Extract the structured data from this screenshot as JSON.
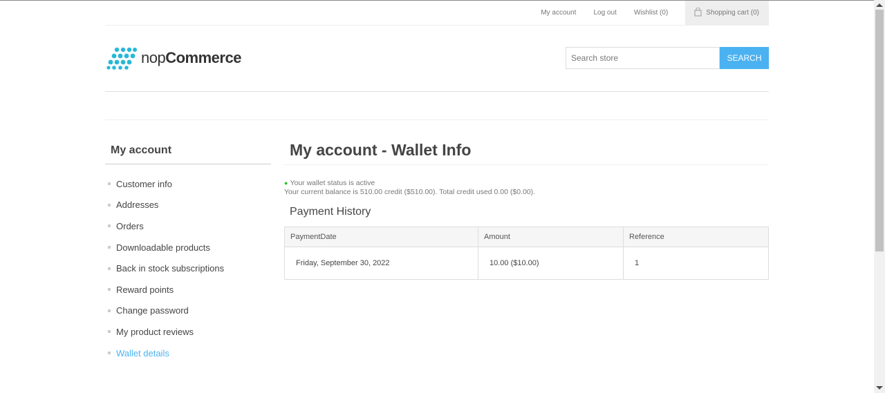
{
  "header": {
    "links": {
      "my_account": "My account",
      "log_out": "Log out",
      "wishlist": "Wishlist (0)",
      "shopping_cart": "Shopping cart (0)"
    },
    "logo": {
      "prefix": "nop",
      "brand": "Commerce"
    },
    "search": {
      "placeholder": "Search store",
      "button_label": "SEARCH"
    }
  },
  "sidebar": {
    "title": "My account",
    "items": [
      {
        "label": "Customer info"
      },
      {
        "label": "Addresses"
      },
      {
        "label": "Orders"
      },
      {
        "label": "Downloadable products"
      },
      {
        "label": "Back in stock subscriptions"
      },
      {
        "label": "Reward points"
      },
      {
        "label": "Change password"
      },
      {
        "label": "My product reviews"
      },
      {
        "label": "Wallet details",
        "active": true
      }
    ]
  },
  "main": {
    "title": "My account - Wallet Info",
    "status_text": "Your wallet status is active",
    "balance_text": "Your current balance is 510.00 credit ($510.00). Total credit used 0.00 ($0.00).",
    "section_title": "Payment History",
    "table": {
      "headers": [
        "PaymentDate",
        "Amount",
        "Reference"
      ],
      "rows": [
        [
          "Friday, September 30, 2022",
          "10.00 ($10.00)",
          "1"
        ]
      ]
    }
  },
  "colors": {
    "accent": "#4ab2f1",
    "status_active": "#25c225",
    "logo_dots": "#27b8d6"
  }
}
